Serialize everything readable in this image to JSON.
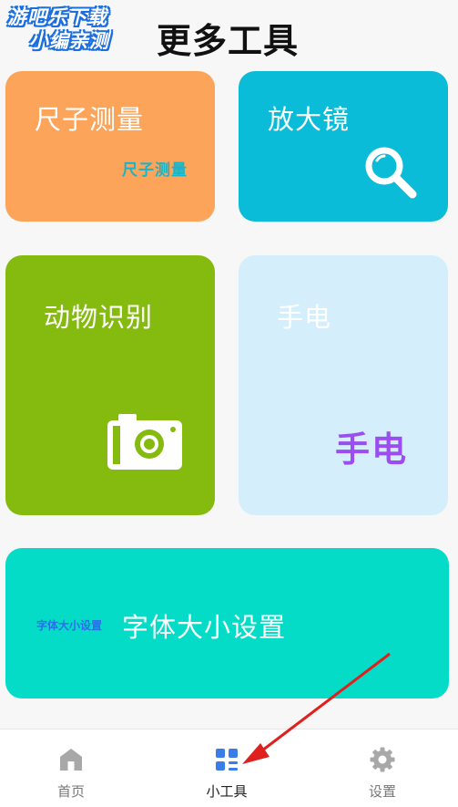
{
  "watermark": {
    "line1": "游吧乐下载",
    "line2": "小编亲测"
  },
  "header": {
    "title": "更多工具"
  },
  "tools": {
    "ruler": {
      "title": "尺子测量",
      "badge": "尺子测量"
    },
    "magnifier": {
      "title": "放大镜",
      "icon": "magnifier-icon"
    },
    "animal": {
      "title": "动物识别",
      "icon": "camera-icon"
    },
    "flashlight": {
      "title": "手电",
      "badge": "手电"
    },
    "font": {
      "title": "字体大小设置",
      "badge": "字体大小设置"
    }
  },
  "tabbar": {
    "items": [
      {
        "label": "首页",
        "icon": "home-icon",
        "active": false
      },
      {
        "label": "小工具",
        "icon": "grid-icon",
        "active": true
      },
      {
        "label": "设置",
        "icon": "gear-icon",
        "active": false
      }
    ]
  },
  "colors": {
    "ruler": "#fca45a",
    "magnifier": "#0bbcd8",
    "animal": "#85ba0e",
    "flashlight": "#d4eefc",
    "font": "#04dcc8",
    "active_tab_icon": "#3b7de8",
    "inactive_tab_icon": "#a8a8a8",
    "annotation_arrow": "#e0201c"
  }
}
